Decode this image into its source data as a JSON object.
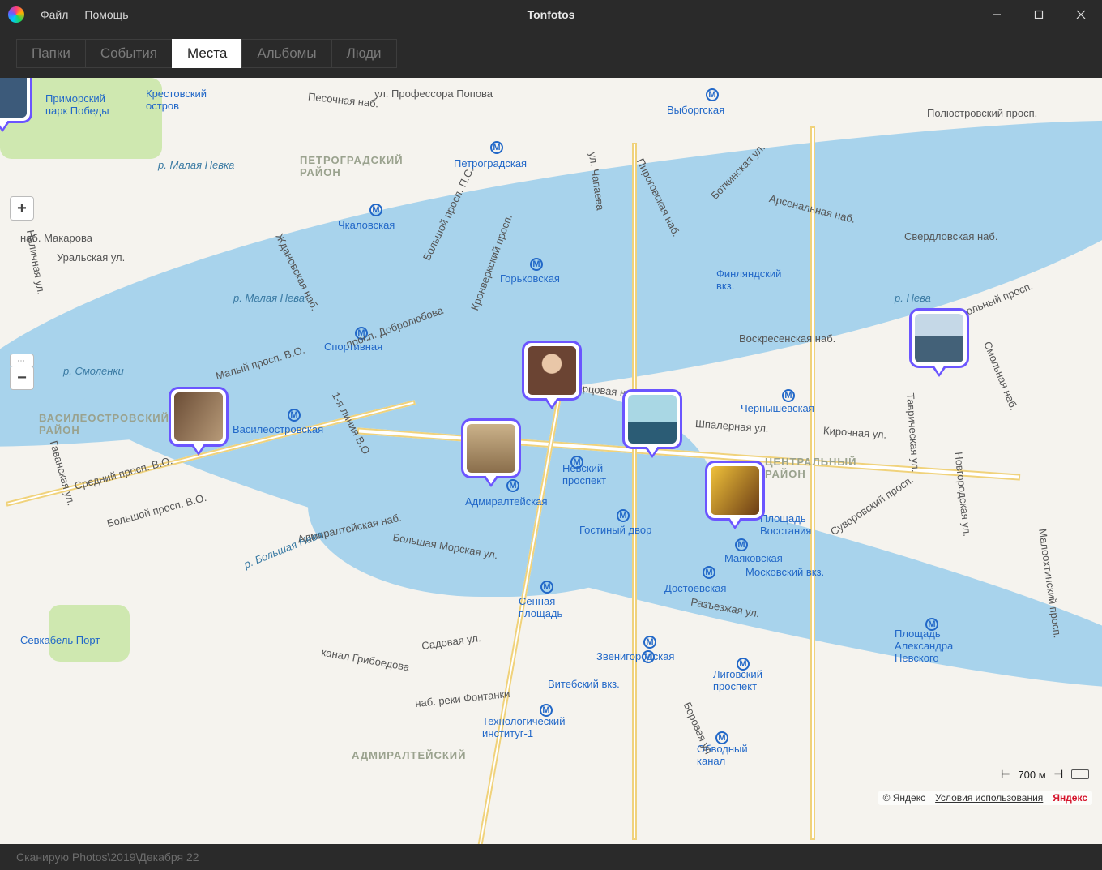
{
  "window": {
    "title": "Tonfotos"
  },
  "menu": {
    "file": "Файл",
    "help": "Помощь"
  },
  "tabs": {
    "folders": "Папки",
    "events": "События",
    "places": "Места",
    "albums": "Альбомы",
    "people": "Люди",
    "active": "places"
  },
  "map": {
    "provider": "Яндекс",
    "scale_label": "700 м",
    "attribution": {
      "copyright": "© Яндекс",
      "terms": "Условия использования"
    },
    "labels": {
      "primorsky": "Приморский\nпарк Победы",
      "krestovsky": "Крестовский\nостров",
      "popova": "ул. Профессора Попова",
      "petrograd": "Петроградская",
      "petrograd_rn": "ПЕТРОГРАДСКИЙ\nРАЙОН",
      "vyborgskaya": "Выборгская",
      "polustr": "Полюстровский просп.",
      "chkalov": "Чкаловская",
      "malaya_nevka": "р. Малая Невка",
      "bolshoy_ps": "Большой просп. П.С.",
      "zhdanov": "Ждановская наб.",
      "makarova": "наб. Макарова",
      "malaya_neva": "р. Малая Нева",
      "gorkov": "Горьковская",
      "dobro": "просп. Добролюбова",
      "sport": "Спортивная",
      "kronv": "Кронверкский просп.",
      "finl": "Финляндский\nвкз.",
      "neva": "р. Нева",
      "sverdl": "Свердловская наб.",
      "smolny": "Смольный просп.",
      "smolnayanab": "Смольная наб.",
      "voskr": "Воскресенская наб.",
      "smolenki": "р. Смоленки",
      "vasileo": "Василеостровская",
      "vasileo_rn": "ВАСИЛЕОСТРОВСКИЙ\nРАЙОН",
      "uralskaya": "Уральская ул.",
      "maly": "Малый просп. В.О.",
      "sredny": "Средний просп. В.О.",
      "bolshoy_vo": "Большой просп. В.О.",
      "gavan": "Гаванская ул.",
      "nalichnaya": "Наличная ул.",
      "nevsky": "Невский\nпроспект",
      "gostiny": "Гостиный двор",
      "admiralty": "Адмиралтейская",
      "sadovaya": "Садовая ул.",
      "sennaya": "Сенная\nплощадь",
      "tech": "Технологический\nинституг-1",
      "vitebsk": "Витебский вкз.",
      "dost": "Достоевская",
      "zvenig": "Звенигородская",
      "ligov": "Лиговский\nпроспект",
      "vosst": "Площадь\nВосстания",
      "mayak": "Маяковская",
      "moskvokzal": "Московский вкз.",
      "chern": "Чернышевская",
      "central_rn": "ЦЕНТРАЛЬНЫЙ\nРАЙОН",
      "tavrich": "Таврическая ул.",
      "novgorod": "Новгородская ул.",
      "maloohta": "Малоохтинский просп.",
      "alexnev": "Площадь\nАлександра\nНевского",
      "obvod": "Обводный\nканал",
      "borov": "Боровая ул.",
      "razezd": "Разъезжая ул.",
      "fontanka": "наб. реки Фонтанки",
      "griboedov": "канал Грибоедова",
      "admiralt_emb": "Адмиралтейская наб.",
      "morskaya": "Большая Морская ул.",
      "dvortsovaya": "Дворцовая наб.",
      "bolshayaneva": "р. Большая Нева",
      "sevkabel": "Севкабель Порт",
      "shpalern": "Шпалерная ул.",
      "kirochn": "Кирочная ул.",
      "admiralt_rn": "АДМИРАЛТЕЙСКИЙ",
      "line1": "1-я линия В.О.",
      "chapaeva": "ул. Чапаева",
      "pirogov": "Пироговская наб.",
      "arsenal": "Арсенальная наб.",
      "botkin": "Боткинская ул.",
      "pesochnaya": "Песочная наб.",
      "suvorov": "Суворовский просп."
    }
  },
  "status": {
    "text": "Сканирую Photos\\2019\\Декабря 22"
  }
}
